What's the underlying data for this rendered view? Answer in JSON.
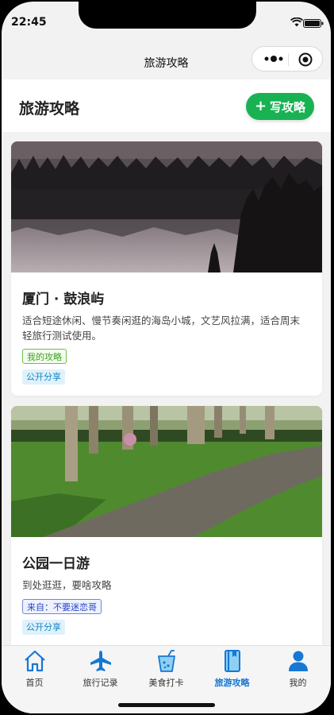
{
  "status": {
    "time": "22:45"
  },
  "nav": {
    "title": "旅游攻略"
  },
  "header": {
    "title": "旅游攻略",
    "write_button": "写攻略"
  },
  "cards": [
    {
      "title": "厦门 · 鼓浪屿",
      "description": "适合短途休闲、慢节奏闲逛的海岛小城，文艺风拉满，适合周末轻旅行测试使用。",
      "tags": [
        "我的攻略",
        "公开分享"
      ]
    },
    {
      "title": "公园一日游",
      "description": "到处逛逛，要啥攻略",
      "tags": [
        "来自：不要迷恋哥",
        "公开分享"
      ]
    }
  ],
  "tabbar": {
    "items": [
      {
        "label": "首页",
        "icon": "home-icon"
      },
      {
        "label": "旅行记录",
        "icon": "airplane-icon"
      },
      {
        "label": "美食打卡",
        "icon": "drink-icon"
      },
      {
        "label": "旅游攻略",
        "icon": "book-icon"
      },
      {
        "label": "我的",
        "icon": "user-icon"
      }
    ],
    "active": "旅游攻略"
  },
  "colors": {
    "accent_green": "#19b253",
    "tab_blue": "#1677d4"
  }
}
